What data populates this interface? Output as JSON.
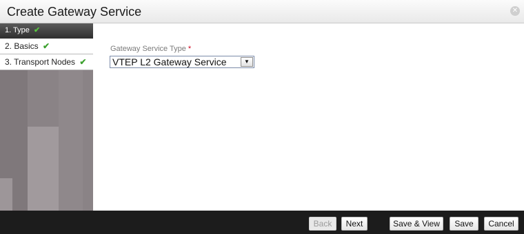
{
  "dialog": {
    "title": "Create Gateway Service",
    "close_icon": "close-icon"
  },
  "wizard": {
    "steps": [
      {
        "label": "1. Type",
        "state": "active",
        "completed": true
      },
      {
        "label": "2. Basics",
        "state": "done",
        "completed": true
      },
      {
        "label": "3. Transport Nodes",
        "state": "done",
        "completed": true
      }
    ],
    "check_glyph": "✔"
  },
  "form": {
    "gateway_service_type": {
      "label": "Gateway Service Type",
      "required_marker": "*",
      "value": "VTEP L2 Gateway Service"
    }
  },
  "footer": {
    "back_label": "Back",
    "next_label": "Next",
    "save_view_label": "Save & View",
    "save_label": "Save",
    "cancel_label": "Cancel"
  },
  "colors": {
    "check": "#3da12f",
    "required": "#d0021b",
    "footer_bg": "#1c1c1c"
  }
}
